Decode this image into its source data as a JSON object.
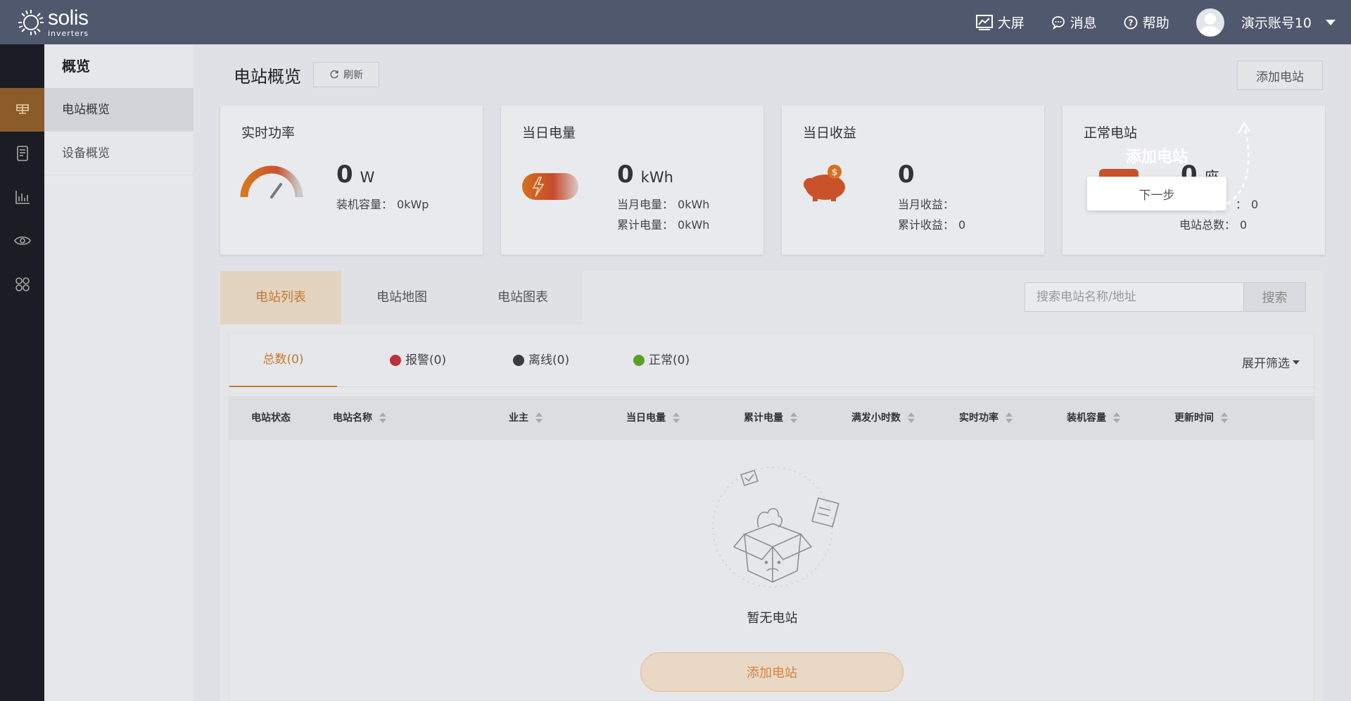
{
  "topbar": {
    "brand": "solis",
    "brand_sub": "inverters",
    "bigscreen_label": "大屏",
    "messages_label": "消息",
    "help_label": "帮助",
    "account_name": "演示账号10"
  },
  "submenu": {
    "header": "概览",
    "items": [
      {
        "label": "电站概览",
        "active": true
      },
      {
        "label": "设备概览",
        "active": false
      }
    ]
  },
  "rail_icons": [
    "station-icon",
    "device-icon",
    "chart-icon",
    "eye-icon",
    "apps-icon"
  ],
  "page": {
    "title": "电站概览",
    "refresh_label": "刷新",
    "add_station_label": "添加电站"
  },
  "cards": {
    "power": {
      "title": "实时功率",
      "value": "0",
      "unit": "W",
      "capacity_label": "装机容量：",
      "capacity_value": "0kWp"
    },
    "energy": {
      "title": "当日电量",
      "value": "0",
      "unit": "kWh",
      "month_label": "当月电量：",
      "month_value": "0kWh",
      "total_label": "累计电量：",
      "total_value": "0kWh"
    },
    "income": {
      "title": "当日收益",
      "value": "0",
      "month_label": "当月收益：",
      "month_value": "",
      "total_label": "累计收益：",
      "total_value": "0"
    },
    "normal": {
      "title": "正常电站",
      "value": "0",
      "unit": "座",
      "sub_value": "0",
      "total_label": "电站总数：",
      "total_value": "0"
    }
  },
  "guide": {
    "title": "添加电站",
    "next_label": "下一步"
  },
  "tabs": [
    {
      "label": "电站列表",
      "active": true
    },
    {
      "label": "电站地图",
      "active": false
    },
    {
      "label": "电站图表",
      "active": false
    }
  ],
  "search": {
    "placeholder": "搜索电站名称/地址",
    "button_label": "搜索"
  },
  "filters": {
    "total": "总数(0)",
    "alarm": "报警(0)",
    "offline": "离线(0)",
    "normal": "正常(0)",
    "expand_label": "展开筛选"
  },
  "status_colors": {
    "alarm": "#b9313a",
    "offline": "#3c3c3c",
    "normal": "#5aa128",
    "accent": "#c7782f"
  },
  "table": {
    "columns": [
      "电站状态",
      "电站名称",
      "业主",
      "当日电量",
      "累计电量",
      "满发小时数",
      "实时功率",
      "装机容量",
      "更新时间"
    ]
  },
  "empty": {
    "text": "暂无电站",
    "button_label": "添加电站"
  }
}
